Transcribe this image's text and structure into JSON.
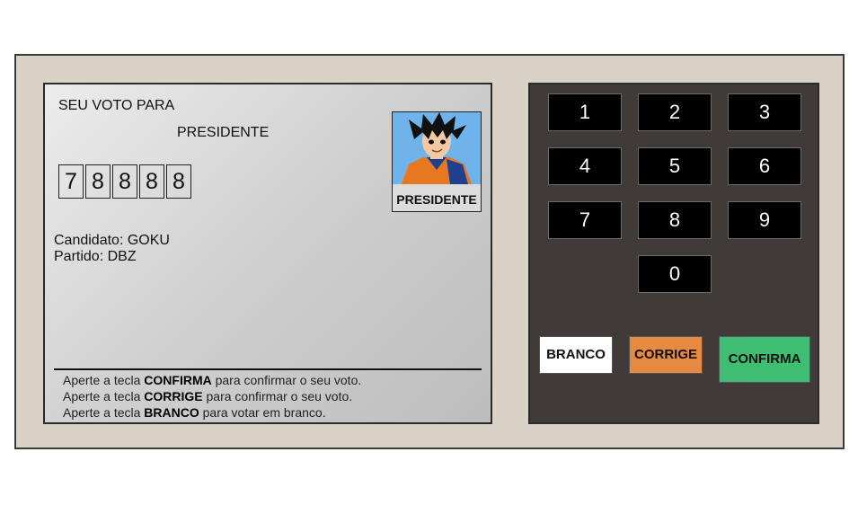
{
  "screen": {
    "vote_for_label": "SEU VOTO PARA",
    "office_label": "PRESIDENTE",
    "digits": [
      "7",
      "8",
      "8",
      "8",
      "8"
    ],
    "candidate_card_label": "PRESIDENTE",
    "candidate_line": "Candidato: GOKU",
    "party_line": "Partido: DBZ",
    "instructions": [
      {
        "prefix": "Aperte a tecla ",
        "key": "CONFIRMA",
        "suffix": " para confirmar o seu voto."
      },
      {
        "prefix": "Aperte a tecla ",
        "key": "CORRIGE",
        "suffix": " para confirmar o seu voto."
      },
      {
        "prefix": "Aperte a tecla ",
        "key": "BRANCO",
        "suffix": " para votar em branco."
      }
    ]
  },
  "keypad": {
    "keys": [
      "1",
      "2",
      "3",
      "4",
      "5",
      "6",
      "7",
      "8",
      "9",
      "0"
    ],
    "branco_label": "BRANCO",
    "corrige_label": "CORRIGE",
    "confirma_label": "CONFIRMA"
  },
  "colors": {
    "machine_bg": "#d9d3c7",
    "keypad_bg": "#403a39",
    "corrige": "#e58a40",
    "confirma": "#3ebd73",
    "branco": "#ffffff"
  }
}
